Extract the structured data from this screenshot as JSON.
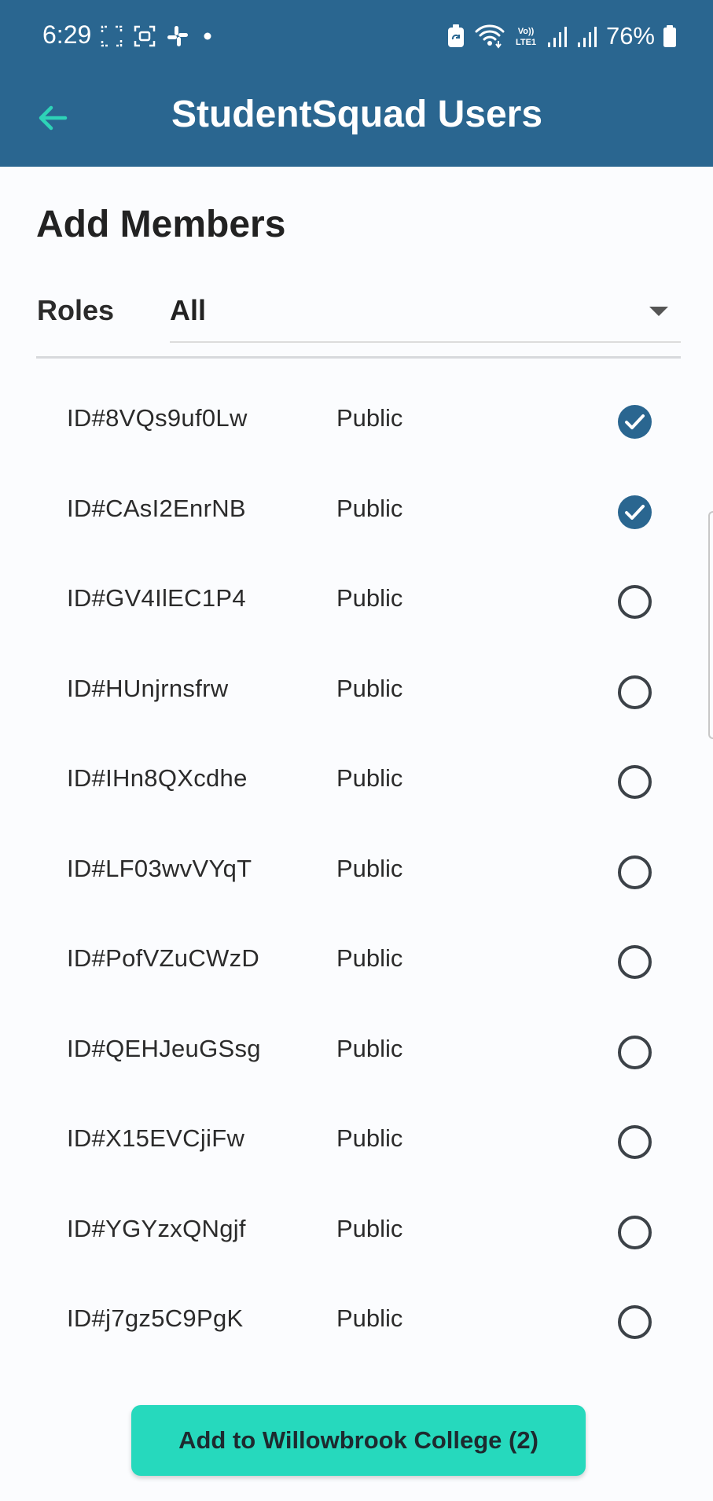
{
  "status_bar": {
    "time": "6:29",
    "battery": "76%",
    "icons": [
      "screenshot-icon",
      "screen-record-icon",
      "slack-icon",
      "dot-icon",
      "battery-saver-icon",
      "wifi-icon",
      "volte-icon",
      "signal-icon",
      "signal-icon",
      "battery-icon"
    ],
    "network_label_top": "Vo))",
    "network_label_bottom": "LTE1"
  },
  "appbar": {
    "title": "StudentSquad Users",
    "back_icon": "arrow-left-icon",
    "accent": "#2ed3b7"
  },
  "page": {
    "section_title": "Add Members",
    "roles_label": "Roles",
    "roles_value": "All"
  },
  "users": [
    {
      "id": "ID#8VQs9uf0Lw",
      "role": "Public",
      "selected": true
    },
    {
      "id": "ID#CAsI2EnrNB",
      "role": "Public",
      "selected": true
    },
    {
      "id": "ID#GV4IlEC1P4",
      "role": "Public",
      "selected": false
    },
    {
      "id": "ID#HUnjrnsfrw",
      "role": "Public",
      "selected": false
    },
    {
      "id": "ID#IHn8QXcdhe",
      "role": "Public",
      "selected": false
    },
    {
      "id": "ID#LF03wvVYqT",
      "role": "Public",
      "selected": false
    },
    {
      "id": "ID#PofVZuCWzD",
      "role": "Public",
      "selected": false
    },
    {
      "id": "ID#QEHJeuGSsg",
      "role": "Public",
      "selected": false
    },
    {
      "id": "ID#X15EVCjiFw",
      "role": "Public",
      "selected": false
    },
    {
      "id": "ID#YGYzxQNgjf",
      "role": "Public",
      "selected": false
    },
    {
      "id": "ID#j7gz5C9PgK",
      "role": "Public",
      "selected": false
    }
  ],
  "action": {
    "add_label": "Add to Willowbrook College (2)"
  },
  "colors": {
    "header": "#2a6690",
    "check": "#2a6690",
    "button": "#26d9bd"
  }
}
